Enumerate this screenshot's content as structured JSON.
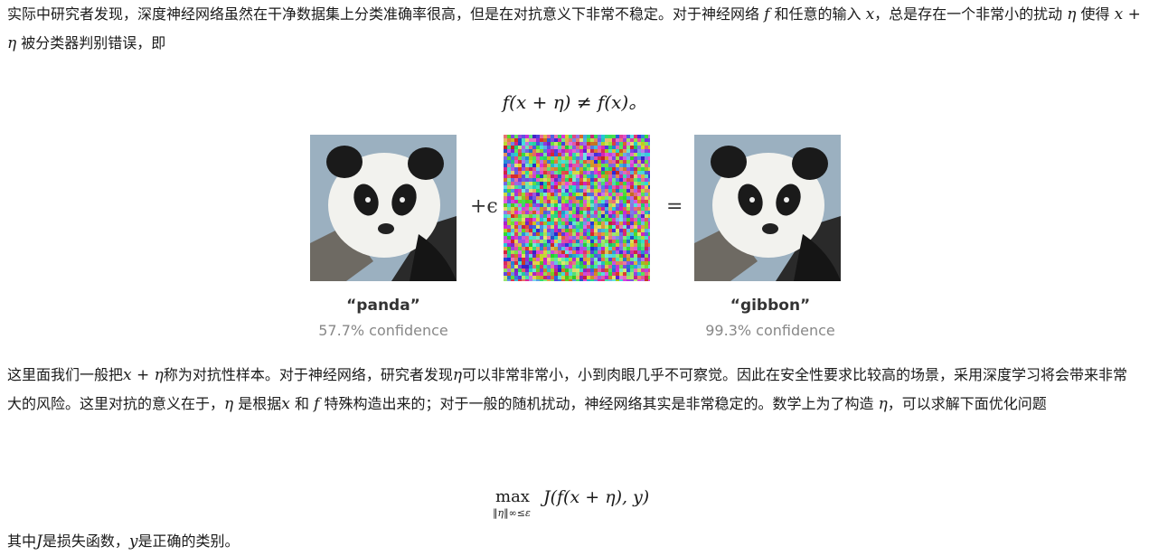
{
  "paragraph1": {
    "text_a": "实际中研究者发现，深度神经网络虽然在干净数据集上分类准确率很高，但是在对抗意义下非常不稳定。对于神经网络 ",
    "math_f": "f",
    "text_b": " 和任意的输入 ",
    "math_x": "x",
    "text_c": "，总是存在一个非常小的扰动 ",
    "math_eta": "η",
    "text_d": " 使得 ",
    "math_sum": "x + η",
    "text_e": " 被分类器判别错误，即"
  },
  "equation1": "f(x + η) ≠ f(x)。",
  "figure": {
    "plus_epsilon": "+ϵ",
    "equals": "=",
    "left_label": "“panda”",
    "left_confidence": "57.7% confidence",
    "right_label": "“gibbon”",
    "right_confidence": "99.3% confidence"
  },
  "paragraph2": {
    "t1": "这里面我们一般把",
    "m1": "x + η",
    "t2": "称为对抗性样本。对于神经网络，研究者发现",
    "m2": "η",
    "t3": "可以非常非常小，小到肉眼几乎不可察觉。因此在安全性要求比较高的场景，采用深度学习将会带来非常大的风险。这里对抗的意义在于，",
    "m3": "η",
    "t4": " 是根据",
    "m4": "x",
    "t5": " 和 ",
    "m5": "f",
    "t6": " 特殊构造出来的；对于一般的随机扰动，神经网络其实是非常稳定的。数学上为了构造 ",
    "m6": "η",
    "t7": "，可以求解下面优化问题"
  },
  "equation2": {
    "max": "max",
    "subscript": "‖η‖∞≤ε",
    "body": "J(f(x + η), y)"
  },
  "paragraph3": {
    "t1": "其中",
    "m1": "J",
    "t2": "是损失函数，",
    "m2": "y",
    "t3": "是正确的类别。"
  }
}
